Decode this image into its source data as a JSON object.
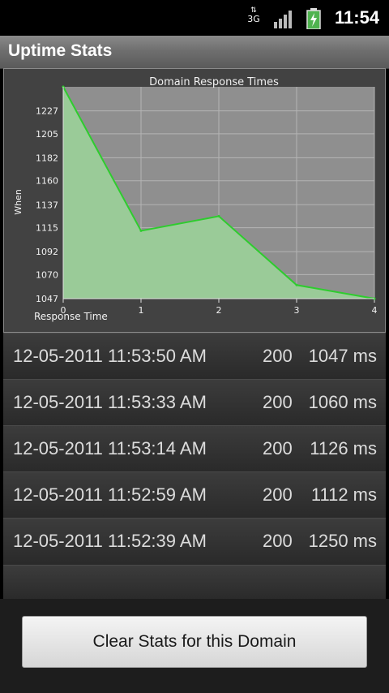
{
  "status_bar": {
    "network": "3G",
    "time": "11:54",
    "network_icon": "3g-icon",
    "signal_icon": "signal-icon",
    "battery_icon": "battery-charging-icon"
  },
  "app": {
    "title": "Uptime Stats"
  },
  "chart_data": {
    "type": "area",
    "title": "Domain Response Times",
    "xlabel": "Response Time",
    "ylabel": "When",
    "x": [
      0,
      1,
      2,
      3,
      4
    ],
    "y": [
      1250,
      1112,
      1126,
      1060,
      1047
    ],
    "xticks": [
      0,
      1,
      2,
      3,
      4
    ],
    "yticks": [
      1047,
      1070,
      1092,
      1115,
      1137,
      1160,
      1182,
      1205,
      1227
    ],
    "xlim": [
      0,
      4
    ],
    "ylim": [
      1047,
      1250
    ],
    "grid": true,
    "line_color": "#2ecc2e",
    "fill_color": "#9acb98",
    "plot_background": "#8f8f8f"
  },
  "stats": [
    {
      "date": "12-05-2011 11:53:50 AM",
      "code": "200",
      "time": "1047 ms"
    },
    {
      "date": "12-05-2011 11:53:33 AM",
      "code": "200",
      "time": "1060 ms"
    },
    {
      "date": "12-05-2011 11:53:14 AM",
      "code": "200",
      "time": "1126 ms"
    },
    {
      "date": "12-05-2011 11:52:59 AM",
      "code": "200",
      "time": "1112 ms"
    },
    {
      "date": "12-05-2011 11:52:39 AM",
      "code": "200",
      "time": "1250 ms"
    }
  ],
  "clear_button": {
    "label": "Clear Stats for this Domain"
  }
}
